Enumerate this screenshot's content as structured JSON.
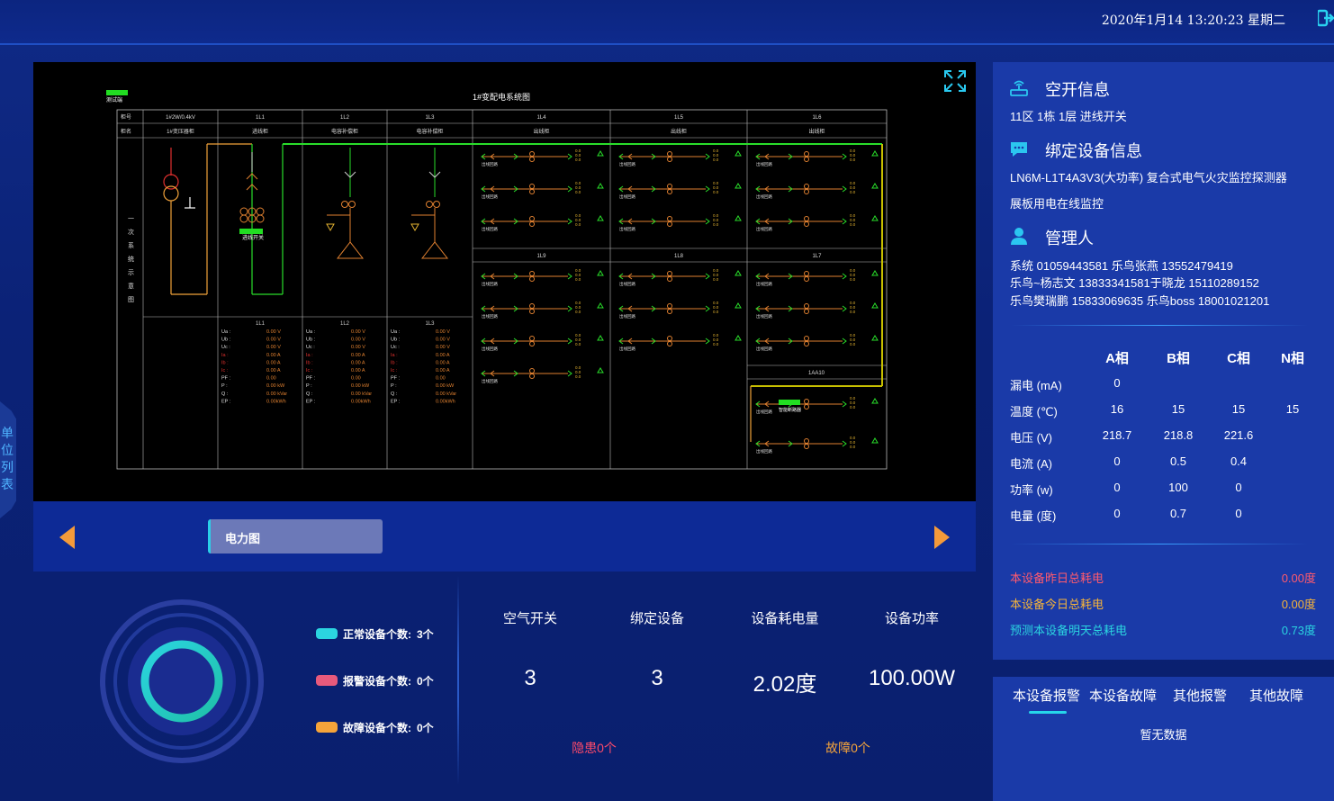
{
  "header": {
    "datetime": "2020年1月14 13:20:23 星期二"
  },
  "side_tab": {
    "label": "单位列表"
  },
  "diagram": {
    "title": "1#变配电系统图",
    "badge": "测试端",
    "row_label_1": "柜号",
    "row_label_2": "柜名",
    "vertical_label": "一次系统示意图",
    "columns": [
      {
        "num": "1#2W/0.4kV",
        "name": "1#变压器柜"
      },
      {
        "num": "1L1",
        "name": "进线柜"
      },
      {
        "num": "1L2",
        "name": "电容补偿柜"
      },
      {
        "num": "1L3",
        "name": "电容补偿柜"
      },
      {
        "num": "1L4",
        "name": "出线柜"
      },
      {
        "num": "1L5",
        "name": "出线柜"
      },
      {
        "num": "1L6",
        "name": "出线柜"
      }
    ],
    "lower_columns": [
      "1L9",
      "1L8",
      "1L7"
    ],
    "meter_titles": [
      "1L1",
      "1L2",
      "1L3"
    ],
    "meter_rows": [
      "Ua :",
      "Ub :",
      "Uc :",
      "Ia :",
      "Ib :",
      "Ic :",
      "PF :",
      "P :",
      "Q :",
      "EP :"
    ],
    "meter_values": [
      "0.00 V",
      "0.00 V",
      "0.00 V",
      "0.00 A",
      "0.00 A",
      "0.00 A",
      "0.00",
      "0.00 kW",
      "0.00 kVar",
      "0.00kWh"
    ],
    "switch_badge": "进线开关",
    "sub_badge": "智能断路器",
    "sub_box": "1AA10",
    "feeder_label": "出线回路",
    "feeder_value": "0.0"
  },
  "tabs": {
    "active": "电力图"
  },
  "summary": {
    "legend": [
      {
        "label": "正常设备个数:",
        "count": "3个",
        "color": "#2bd4e0"
      },
      {
        "label": "报警设备个数:",
        "count": "0个",
        "color": "#e85a7c"
      },
      {
        "label": "故障设备个数:",
        "count": "0个",
        "color": "#f6a43a"
      }
    ],
    "stats": [
      {
        "label": "空气开关",
        "value": "3"
      },
      {
        "label": "绑定设备",
        "value": "3"
      },
      {
        "label": "设备耗电量",
        "value": "2.02度"
      },
      {
        "label": "设备功率",
        "value": "100.00W"
      }
    ],
    "hazard": {
      "label": "隐患0个",
      "color": "#ff4a6a"
    },
    "fault": {
      "label": "故障0个",
      "color": "#f6a43a"
    }
  },
  "info": {
    "switch_title": "空开信息",
    "switch_text": "11区 1栋 1层 进线开关",
    "device_title": "绑定设备信息",
    "device_line1": "LN6M-L1T4A3V3(大功率)  复合式电气火灾监控探测器",
    "device_line2": "展板用电在线监控",
    "manager_title": "管理人",
    "managers": [
      "系统 01059443581     乐鸟张燕 13552479419",
      "乐鸟~杨志文 13833341581于晓龙 15110289152",
      "乐鸟樊瑞鹏 15833069635  乐鸟boss 18001021201"
    ],
    "phases": [
      "A相",
      "B相",
      "C相",
      "N相"
    ],
    "rows": [
      {
        "label": "漏电 (mA)",
        "values": [
          "0",
          "",
          "",
          ""
        ]
      },
      {
        "label": "温度 (℃)",
        "values": [
          "16",
          "15",
          "15",
          "15"
        ]
      },
      {
        "label": "电压 (V)",
        "values": [
          "218.7",
          "218.8",
          "221.6",
          ""
        ]
      },
      {
        "label": "电流 (A)",
        "values": [
          "0",
          "0.5",
          "0.4",
          ""
        ]
      },
      {
        "label": "功率 (w)",
        "values": [
          "0",
          "100",
          "0",
          ""
        ]
      },
      {
        "label": "电量 (度)",
        "values": [
          "0",
          "0.7",
          "0",
          ""
        ]
      }
    ],
    "energy": [
      {
        "label": "本设备昨日总耗电",
        "value": "0.00度",
        "color": "#ff5a6e"
      },
      {
        "label": "本设备今日总耗电",
        "value": "0.00度",
        "color": "#f6b43a"
      },
      {
        "label": "预测本设备明天总耗电",
        "value": "0.73度",
        "color": "#2bd4e0"
      }
    ]
  },
  "alarms": {
    "tabs": [
      "本设备报警",
      "本设备故障",
      "其他报警",
      "其他故障"
    ],
    "empty": "暂无数据"
  }
}
